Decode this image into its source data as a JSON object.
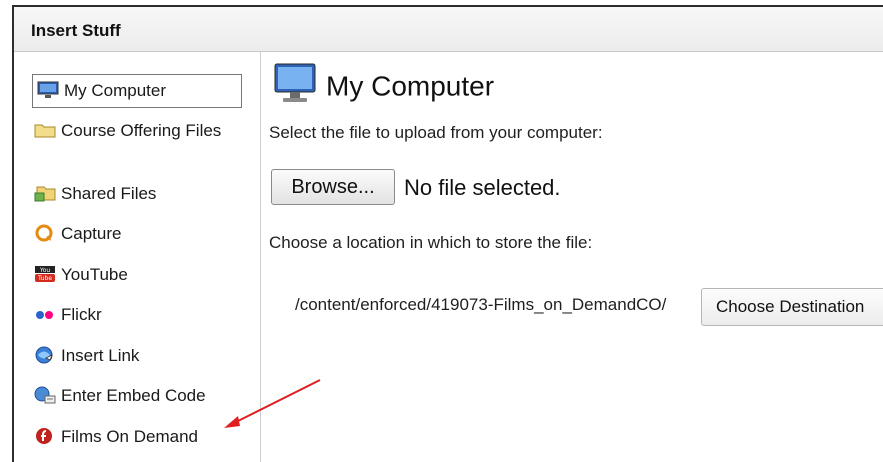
{
  "dialog": {
    "title": "Insert Stuff"
  },
  "sidebar": {
    "items": [
      {
        "label": "My Computer",
        "icon": "monitor-icon"
      },
      {
        "label": "Course Offering Files",
        "icon": "folder-icon"
      },
      {
        "label": "Shared Files",
        "icon": "shared-folder-icon"
      },
      {
        "label": "Capture",
        "icon": "capture-icon"
      },
      {
        "label": "YouTube",
        "icon": "youtube-icon"
      },
      {
        "label": "Flickr",
        "icon": "flickr-icon"
      },
      {
        "label": "Insert Link",
        "icon": "globe-link-icon"
      },
      {
        "label": "Enter Embed Code",
        "icon": "embed-code-icon"
      },
      {
        "label": "Films On Demand",
        "icon": "films-on-demand-icon"
      }
    ]
  },
  "main": {
    "heading": "My Computer",
    "instruction_file": "Select the file to upload from your computer:",
    "browse_label": "Browse...",
    "file_status": "No file selected.",
    "instruction_location": "Choose a location in which to store the file:",
    "destination_path": "/content/enforced/419073-Films_on_DemandCO/",
    "choose_destination_label": "Choose Destination"
  },
  "colors": {
    "annotation_arrow": "#e02020",
    "youtube_red": "#d42b1e",
    "flickr_blue": "#2a63c9",
    "flickr_pink": "#ff0084"
  }
}
